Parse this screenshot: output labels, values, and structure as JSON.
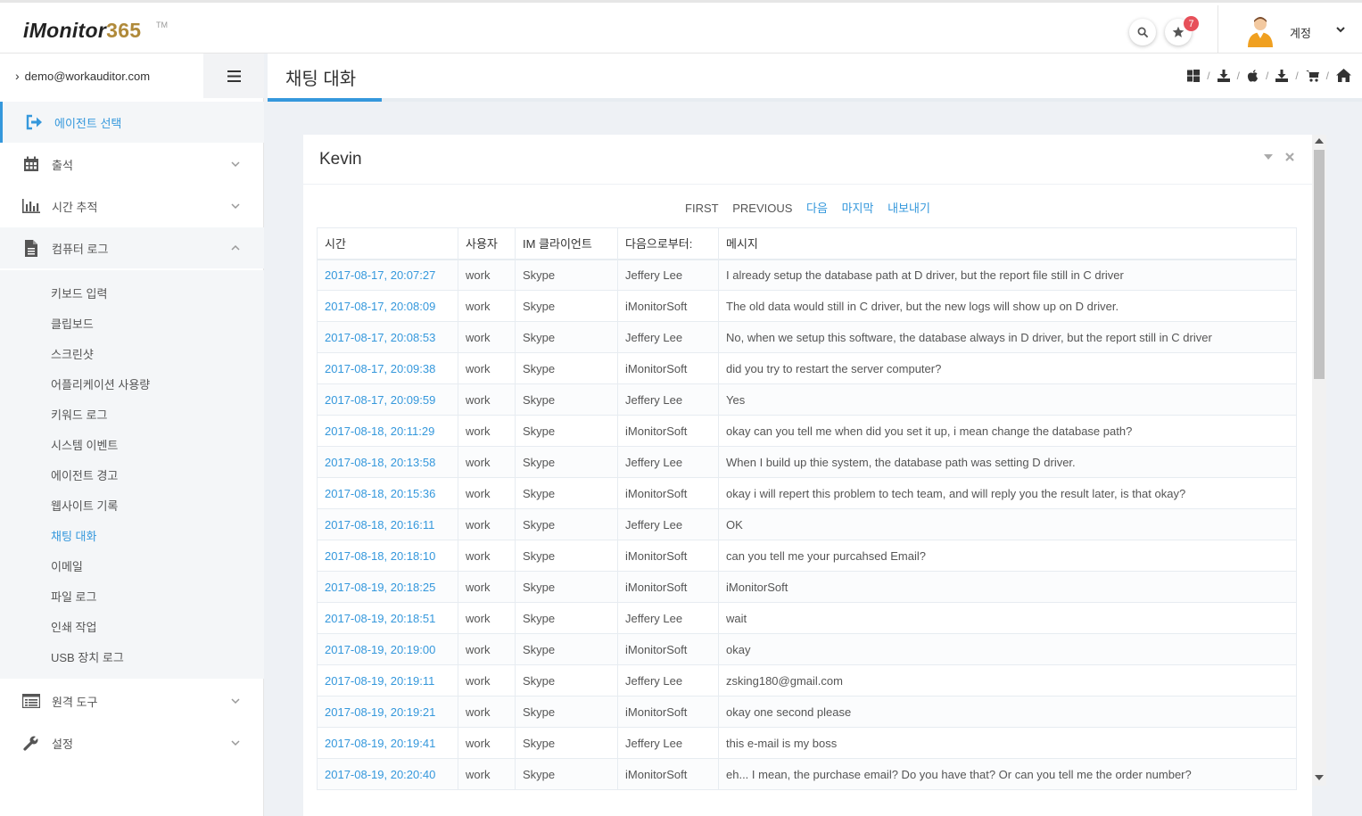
{
  "app": {
    "logo_prefix": "iMonitor",
    "logo_suffix": "365",
    "logo_tm": "TM"
  },
  "header": {
    "notification_count": "7",
    "account_label": "계정"
  },
  "sidebar": {
    "user_email": "demo@workauditor.com",
    "menu": [
      {
        "label": "에이전트 선택",
        "icon": "sign-in-icon",
        "active": true
      },
      {
        "label": "출석",
        "icon": "calendar-icon"
      },
      {
        "label": "시간 추적",
        "icon": "bar-chart-icon"
      },
      {
        "label": "컴퓨터 로그",
        "icon": "file-icon",
        "open": true
      }
    ],
    "submenu": [
      "키보드 입력",
      "클립보드",
      "스크린샷",
      "어플리케이션 사용량",
      "키워드 로그",
      "시스템 이벤트",
      "에이전트 경고",
      "웹사이트 기록",
      "채팅 대화",
      "이메일",
      "파일 로그",
      "인쇄 작업",
      "USB 장치 로그"
    ],
    "current_sub": "채팅 대화",
    "menu_bottom": [
      {
        "label": "원격 도구",
        "icon": "list-icon"
      },
      {
        "label": "설정",
        "icon": "wrench-icon"
      }
    ]
  },
  "page": {
    "title": "채팅 대화"
  },
  "portlet": {
    "title": "Kevin",
    "pager": {
      "first": "FIRST",
      "previous": "PREVIOUS",
      "next": "다음",
      "last": "마지막",
      "export": "내보내기"
    },
    "columns": [
      "시간",
      "사용자",
      "IM 클라이언트",
      "다음으로부터:",
      "메시지"
    ],
    "rows": [
      [
        "2017-08-17, 20:07:27",
        "work",
        "Skype",
        "Jeffery Lee",
        "I already setup the database path at D driver, but the report file still in C driver"
      ],
      [
        "2017-08-17, 20:08:09",
        "work",
        "Skype",
        "iMonitorSoft",
        "The old data would still in C driver, but the new logs will show up on D driver."
      ],
      [
        "2017-08-17, 20:08:53",
        "work",
        "Skype",
        "Jeffery Lee",
        "No, when we setup this software, the database always in D driver, but the report still in C driver"
      ],
      [
        "2017-08-17, 20:09:38",
        "work",
        "Skype",
        "iMonitorSoft",
        "did you try to restart the server computer?"
      ],
      [
        "2017-08-17, 20:09:59",
        "work",
        "Skype",
        "Jeffery Lee",
        "Yes"
      ],
      [
        "2017-08-18, 20:11:29",
        "work",
        "Skype",
        "iMonitorSoft",
        "okay can you tell me when did you set it up, i mean change the database path?"
      ],
      [
        "2017-08-18, 20:13:58",
        "work",
        "Skype",
        "Jeffery Lee",
        "When I build up thie system, the database path was setting D driver."
      ],
      [
        "2017-08-18, 20:15:36",
        "work",
        "Skype",
        "iMonitorSoft",
        "okay i will repert this problem to tech team, and will reply you the result later, is that okay?"
      ],
      [
        "2017-08-18, 20:16:11",
        "work",
        "Skype",
        "Jeffery Lee",
        "OK"
      ],
      [
        "2017-08-18, 20:18:10",
        "work",
        "Skype",
        "iMonitorSoft",
        "can you tell me your purcahsed Email?"
      ],
      [
        "2017-08-19, 20:18:25",
        "work",
        "Skype",
        "iMonitorSoft",
        "iMonitorSoft"
      ],
      [
        "2017-08-19, 20:18:51",
        "work",
        "Skype",
        "Jeffery Lee",
        "wait"
      ],
      [
        "2017-08-19, 20:19:00",
        "work",
        "Skype",
        "iMonitorSoft",
        "okay"
      ],
      [
        "2017-08-19, 20:19:11",
        "work",
        "Skype",
        "Jeffery Lee",
        "zsking180@gmail.com"
      ],
      [
        "2017-08-19, 20:19:21",
        "work",
        "Skype",
        "iMonitorSoft",
        "okay one second please"
      ],
      [
        "2017-08-19, 20:19:41",
        "work",
        "Skype",
        "Jeffery Lee",
        "this e-mail is my boss"
      ],
      [
        "2017-08-19, 20:20:40",
        "work",
        "Skype",
        "iMonitorSoft",
        "eh... I mean, the purchase email? Do you have that? Or can you tell me the order number?"
      ]
    ]
  },
  "colors": {
    "accent": "#3598dc",
    "badge": "#e7505a",
    "logo_gold": "#b08a3a"
  }
}
